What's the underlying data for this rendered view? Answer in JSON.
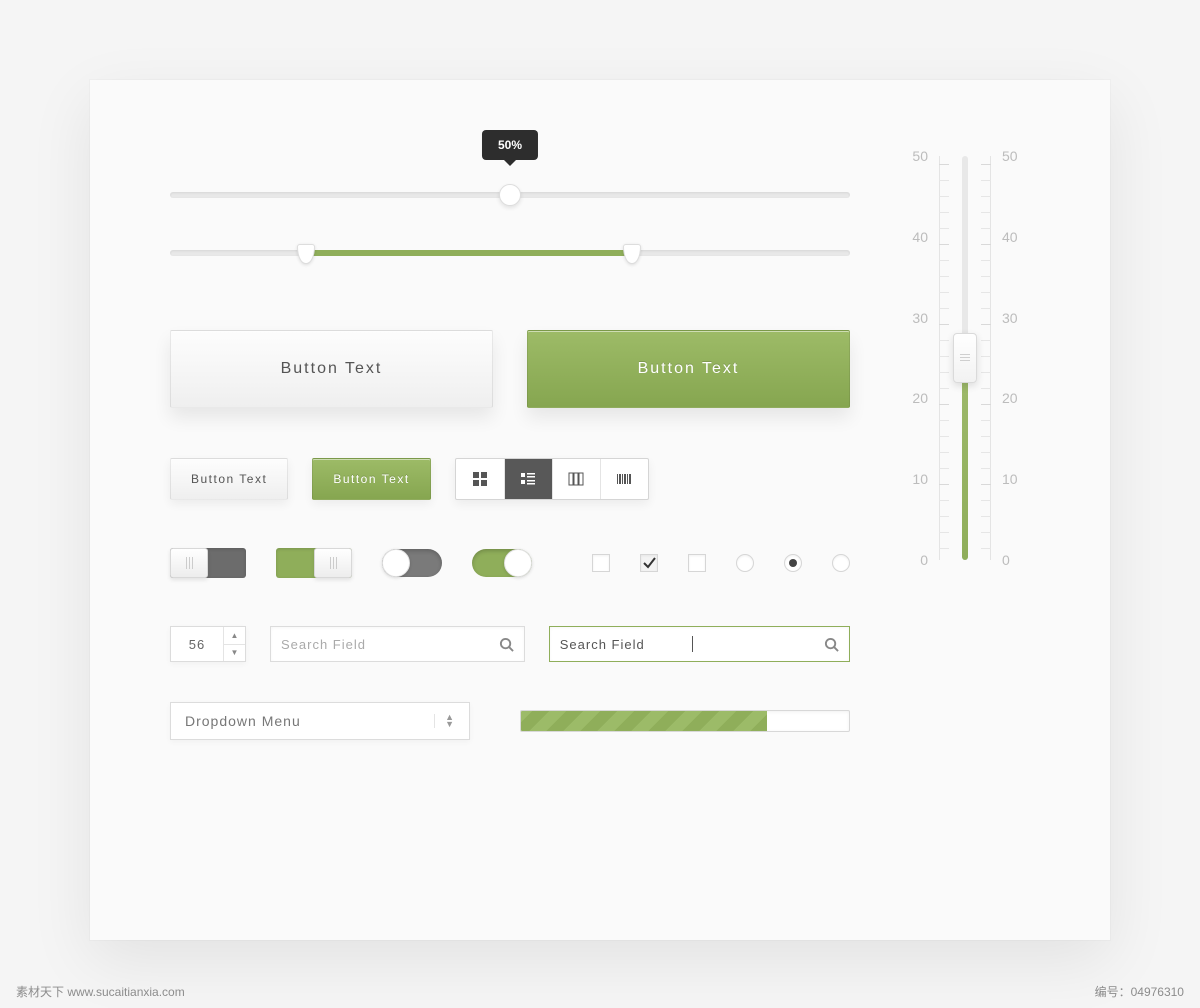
{
  "tooltip_value": "50%",
  "buttons": {
    "big_light": "Button Text",
    "big_green": "Button Text",
    "small_light": "Button Text",
    "small_green": "Button Text"
  },
  "segments": {
    "grid_icon": "grid-icon",
    "list_icon": "list-icon",
    "columns_icon": "columns-icon",
    "barcode_icon": "barcode-icon"
  },
  "stepper_value": "56",
  "search1_placeholder": "Search Field",
  "search2_placeholder": "Search Field",
  "dropdown_label": "Dropdown Menu",
  "progress_pct": 75,
  "vscale": [
    "50",
    "40",
    "30",
    "20",
    "10",
    "0"
  ],
  "colors": {
    "accent": "#8fae5a",
    "dark": "#585858"
  },
  "footer": {
    "left": "素材天下 www.sucaitianxia.com",
    "right": "编号：04976310"
  }
}
